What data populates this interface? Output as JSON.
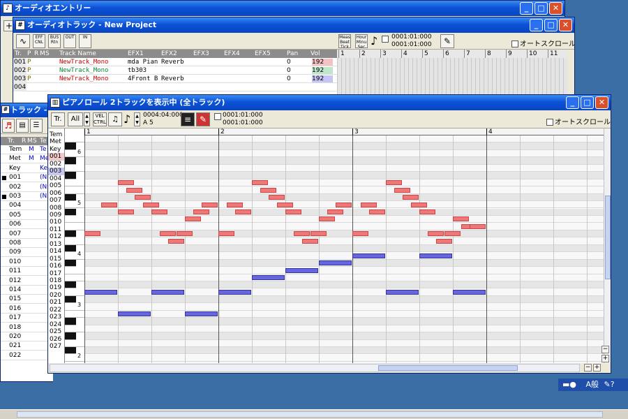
{
  "colors": {
    "title_bar": "#0b52d8",
    "note_red": "#ee7777",
    "note_blue": "#6666dd",
    "vol_red": "#f4c4c4",
    "vol_green": "#bde8cc",
    "vol_blue": "#c6c6f4"
  },
  "audio_entry": {
    "title": "オーディオエントリー",
    "icon": "app-icon"
  },
  "audio_track": {
    "title": "オーディオトラック - New Project",
    "tools": [
      {
        "label": "EFF CNL"
      },
      {
        "label": "BUS Rtn"
      },
      {
        "label": "OUT"
      },
      {
        "label": "IN"
      }
    ],
    "time_buttons": [
      {
        "label": "Meas Beat Tick"
      },
      {
        "label": "Hour Minu Sec"
      }
    ],
    "time_top": "0001:01:000",
    "time_bottom": "0001:01:000",
    "autoscroll": "オートスクロール",
    "columns": [
      "Tr.",
      "P",
      "R",
      "M",
      "S",
      "Track Name",
      "EFX1",
      "EFX2",
      "EFX3",
      "EFX4",
      "EFX5",
      "Pan",
      "Vol"
    ],
    "measures": [
      "1",
      "2",
      "3",
      "4",
      "5",
      "6",
      "7",
      "8",
      "9",
      "10",
      "11"
    ],
    "rows": [
      {
        "tr": "001",
        "p": "P",
        "name": "NewTrack_Mono",
        "efx1": "mda Pian",
        "efx2": "Reverb",
        "pan": "0",
        "vol": "192"
      },
      {
        "tr": "002",
        "p": "P",
        "name": "NewTrack_Mono",
        "efx1": "tb303",
        "efx2": "",
        "pan": "0",
        "vol": "192"
      },
      {
        "tr": "003",
        "p": "P",
        "name": "NewTrack_Mono",
        "efx1": "4Front B",
        "efx2": "Reverb",
        "pan": "0",
        "vol": "192"
      },
      {
        "tr": "004",
        "p": "",
        "name": "",
        "efx1": "",
        "efx2": "",
        "pan": "",
        "vol": ""
      }
    ]
  },
  "track_window": {
    "title": "トラック - Ne",
    "columns": [
      "Tr.",
      "R",
      "M",
      "S",
      "Te"
    ],
    "rows": [
      {
        "tr": "Tem",
        "m": "M",
        "te": "Te",
        "mark": ""
      },
      {
        "tr": "Met",
        "m": "M",
        "te": "Me",
        "mark": ""
      },
      {
        "tr": "Key",
        "m": "",
        "te": "Ke",
        "mark": ""
      },
      {
        "tr": "001",
        "m": "",
        "te": "(N",
        "mark": "■"
      },
      {
        "tr": "002",
        "m": "",
        "te": "(N",
        "mark": ""
      },
      {
        "tr": "003",
        "m": "",
        "te": "(N",
        "mark": "■"
      },
      {
        "tr": "004",
        "m": "",
        "te": "",
        "mark": ""
      },
      {
        "tr": "005",
        "m": "",
        "te": "",
        "mark": ""
      },
      {
        "tr": "006",
        "m": "",
        "te": "",
        "mark": ""
      },
      {
        "tr": "007",
        "m": "",
        "te": "",
        "mark": ""
      },
      {
        "tr": "008",
        "m": "",
        "te": "",
        "mark": ""
      },
      {
        "tr": "009",
        "m": "",
        "te": "",
        "mark": ""
      },
      {
        "tr": "010",
        "m": "",
        "te": "",
        "mark": ""
      },
      {
        "tr": "011",
        "m": "",
        "te": "",
        "mark": ""
      },
      {
        "tr": "012",
        "m": "",
        "te": "",
        "mark": ""
      },
      {
        "tr": "014",
        "m": "",
        "te": "",
        "mark": ""
      },
      {
        "tr": "015",
        "m": "",
        "te": "",
        "mark": ""
      },
      {
        "tr": "016",
        "m": "",
        "te": "",
        "mark": ""
      },
      {
        "tr": "017",
        "m": "",
        "te": "",
        "mark": ""
      },
      {
        "tr": "018",
        "m": "",
        "te": "",
        "mark": ""
      },
      {
        "tr": "020",
        "m": "",
        "te": "",
        "mark": ""
      },
      {
        "tr": "021",
        "m": "",
        "te": "",
        "mark": ""
      },
      {
        "tr": "022",
        "m": "",
        "te": "",
        "mark": ""
      }
    ]
  },
  "piano_roll": {
    "title": "ピアノロール 2トラックを表示中 (全トラック)",
    "tr_button": "Tr.",
    "all_select": "All",
    "vel_button": "VEL CTRL",
    "position": "0004:04:000",
    "note_name": "A 5",
    "time_top": "0001:01:000",
    "time_bottom": "0001:01:000",
    "autoscroll": "オートスクロール",
    "measures": [
      "1",
      "2",
      "3",
      "4"
    ],
    "track_list": [
      "Tem",
      "Met",
      "Key",
      "001",
      "002",
      "003",
      "004",
      "005",
      "006",
      "007",
      "008",
      "009",
      "010",
      "011",
      "012",
      "013",
      "014",
      "015",
      "016",
      "017",
      "018",
      "019",
      "020",
      "021",
      "022",
      "023",
      "024",
      "025",
      "026",
      "027"
    ],
    "octave_labels": [
      "6",
      "5",
      "4",
      "3",
      "2"
    ],
    "red_notes": [
      {
        "t": 0.0,
        "len": 0.125,
        "row": 13
      },
      {
        "t": 0.125,
        "len": 0.125,
        "row": 9
      },
      {
        "t": 0.25,
        "len": 0.125,
        "row": 10
      },
      {
        "t": 0.25,
        "len": 0.125,
        "row": 6
      },
      {
        "t": 0.3125,
        "len": 0.125,
        "row": 7
      },
      {
        "t": 0.375,
        "len": 0.125,
        "row": 8
      },
      {
        "t": 0.4375,
        "len": 0.125,
        "row": 9
      },
      {
        "t": 0.5,
        "len": 0.125,
        "row": 10
      },
      {
        "t": 0.5625,
        "len": 0.125,
        "row": 13
      },
      {
        "t": 0.625,
        "len": 0.125,
        "row": 14
      },
      {
        "t": 0.6875,
        "len": 0.125,
        "row": 13
      },
      {
        "t": 0.75,
        "len": 0.125,
        "row": 11
      },
      {
        "t": 0.8125,
        "len": 0.125,
        "row": 10
      },
      {
        "t": 0.875,
        "len": 0.125,
        "row": 9
      },
      {
        "t": 1.0,
        "len": 0.125,
        "row": 13
      },
      {
        "t": 1.0625,
        "len": 0.125,
        "row": 9
      },
      {
        "t": 1.125,
        "len": 0.125,
        "row": 10
      },
      {
        "t": 1.25,
        "len": 0.125,
        "row": 6
      },
      {
        "t": 1.3125,
        "len": 0.125,
        "row": 7
      },
      {
        "t": 1.375,
        "len": 0.125,
        "row": 8
      },
      {
        "t": 1.4375,
        "len": 0.125,
        "row": 9
      },
      {
        "t": 1.5,
        "len": 0.125,
        "row": 10
      },
      {
        "t": 1.5625,
        "len": 0.125,
        "row": 13
      },
      {
        "t": 1.625,
        "len": 0.125,
        "row": 14
      },
      {
        "t": 1.6875,
        "len": 0.125,
        "row": 13
      },
      {
        "t": 1.75,
        "len": 0.125,
        "row": 11
      },
      {
        "t": 1.8125,
        "len": 0.125,
        "row": 10
      },
      {
        "t": 1.875,
        "len": 0.125,
        "row": 9
      },
      {
        "t": 2.0,
        "len": 0.125,
        "row": 13
      },
      {
        "t": 2.0625,
        "len": 0.125,
        "row": 9
      },
      {
        "t": 2.125,
        "len": 0.125,
        "row": 10
      },
      {
        "t": 2.25,
        "len": 0.125,
        "row": 6
      },
      {
        "t": 2.3125,
        "len": 0.125,
        "row": 7
      },
      {
        "t": 2.375,
        "len": 0.125,
        "row": 8
      },
      {
        "t": 2.4375,
        "len": 0.125,
        "row": 9
      },
      {
        "t": 2.5,
        "len": 0.125,
        "row": 10
      },
      {
        "t": 2.5625,
        "len": 0.125,
        "row": 13
      },
      {
        "t": 2.625,
        "len": 0.125,
        "row": 14
      },
      {
        "t": 2.6875,
        "len": 0.125,
        "row": 13
      },
      {
        "t": 2.75,
        "len": 0.125,
        "row": 11
      },
      {
        "t": 2.8125,
        "len": 0.125,
        "row": 12
      },
      {
        "t": 2.875,
        "len": 0.125,
        "row": 12
      }
    ],
    "blue_notes": [
      {
        "t": 0.0,
        "len": 0.25,
        "row": 21
      },
      {
        "t": 0.25,
        "len": 0.25,
        "row": 24
      },
      {
        "t": 0.5,
        "len": 0.25,
        "row": 21
      },
      {
        "t": 0.75,
        "len": 0.25,
        "row": 24
      },
      {
        "t": 1.0,
        "len": 0.25,
        "row": 21
      },
      {
        "t": 1.25,
        "len": 0.25,
        "row": 19
      },
      {
        "t": 1.5,
        "len": 0.25,
        "row": 18
      },
      {
        "t": 1.75,
        "len": 0.25,
        "row": 17
      },
      {
        "t": 2.0,
        "len": 0.25,
        "row": 16
      },
      {
        "t": 2.25,
        "len": 0.25,
        "row": 21
      },
      {
        "t": 2.5,
        "len": 0.25,
        "row": 16
      },
      {
        "t": 2.75,
        "len": 0.25,
        "row": 21
      }
    ]
  },
  "tray": {
    "ime": "A般"
  }
}
